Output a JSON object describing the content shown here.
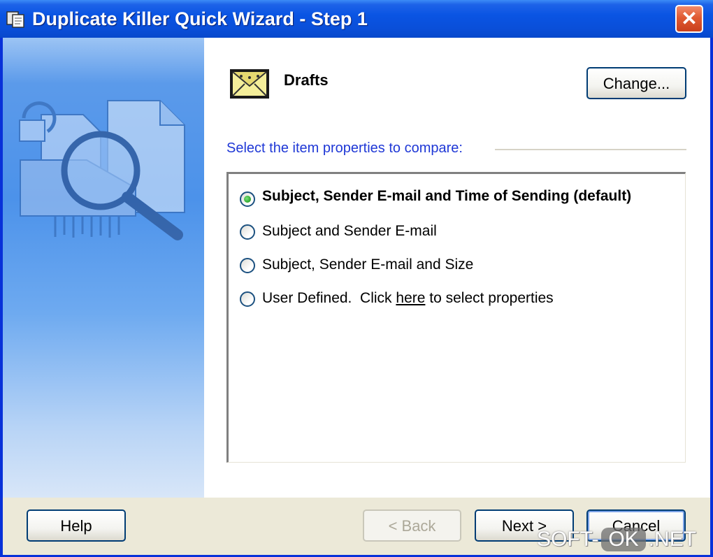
{
  "window": {
    "title": "Duplicate Killer Quick Wizard - Step 1",
    "close_label": "✕"
  },
  "folder": {
    "name": "Drafts",
    "change_label": "Change..."
  },
  "prompt": "Select the item properties to compare:",
  "options": [
    {
      "label": "Subject, Sender E-mail and Time of Sending (default)",
      "checked": true
    },
    {
      "label": "Subject and Sender E-mail",
      "checked": false
    },
    {
      "label": "Subject, Sender E-mail and Size",
      "checked": false
    },
    {
      "label_pre": "User Defined.  Click ",
      "link": "here",
      "label_post": " to select properties",
      "checked": false
    }
  ],
  "buttons": {
    "help": "Help",
    "back": "< Back",
    "next": "Next >",
    "cancel": "Cancel"
  },
  "watermark": {
    "pre": "SOFT-",
    "ok": "OK",
    "post": ".NET"
  },
  "colors": {
    "titlebar": "#0a54e3",
    "prompt": "#1f38d6",
    "dialog_bg": "#ece9d8",
    "radio_checked": "#21a121"
  }
}
